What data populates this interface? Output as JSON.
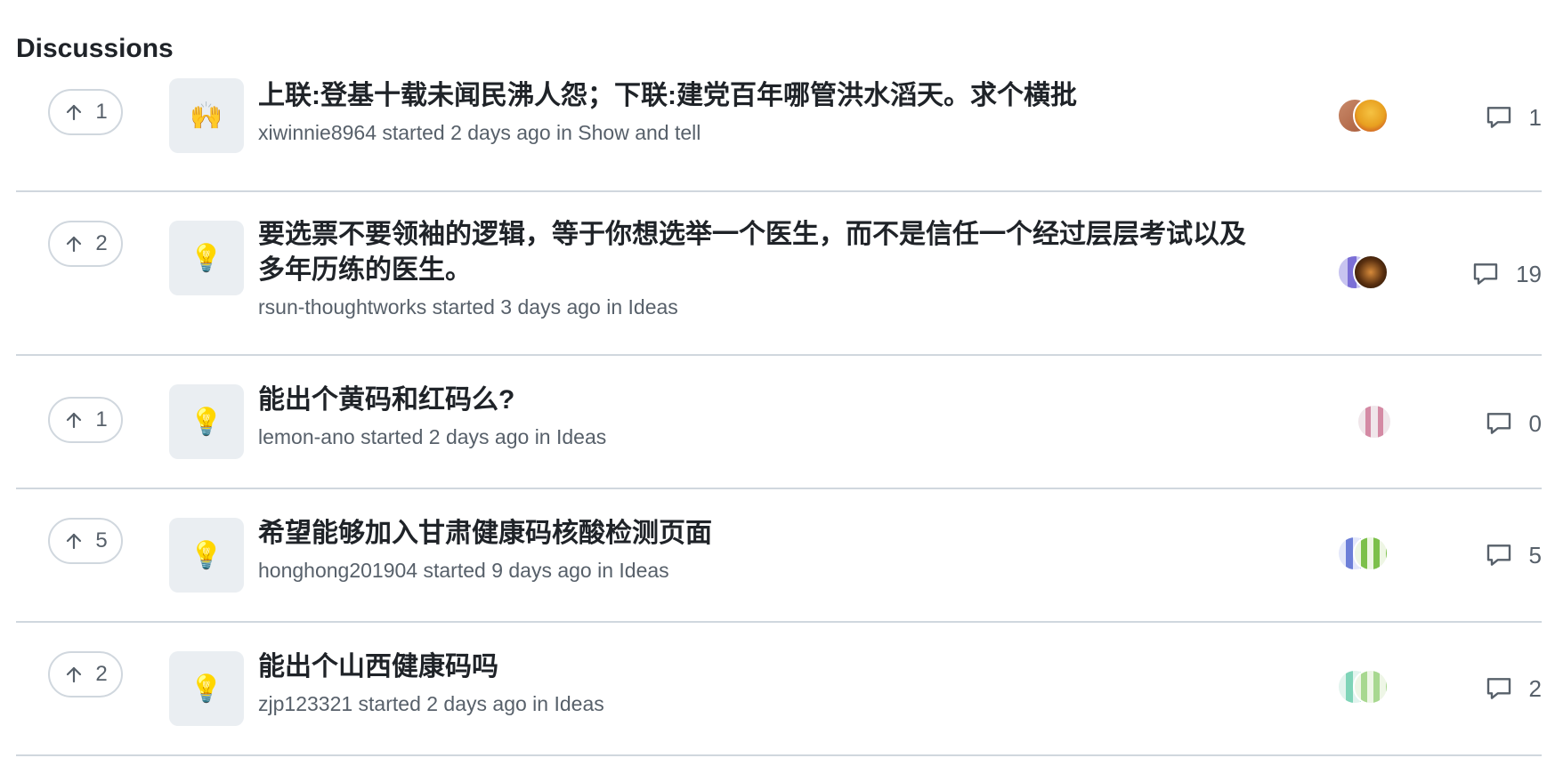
{
  "section": {
    "title": "Discussions"
  },
  "discussions": [
    {
      "votes": "1",
      "category_emoji": "🙌",
      "title": "上联:登基十载未闻民沸人怨；下联:建党百年哪管洪水滔天。求个横批",
      "author": "xiwinnie8964",
      "started": "started 2 days ago in",
      "category": "Show and tell",
      "comments": "1"
    },
    {
      "votes": "2",
      "category_emoji": "💡",
      "title": "要选票不要领袖的逻辑，等于你想选举一个医生，而不是信任一个经过层层考试以及多年历练的医生。",
      "author": "rsun-thoughtworks",
      "started": "started 3 days ago in",
      "category": "Ideas",
      "comments": "19"
    },
    {
      "votes": "1",
      "category_emoji": "💡",
      "title": "能出个黄码和红码么?",
      "author": "lemon-ano",
      "started": "started 2 days ago in",
      "category": "Ideas",
      "comments": "0"
    },
    {
      "votes": "5",
      "category_emoji": "💡",
      "title": "希望能够加入甘肃健康码核酸检测页面",
      "author": "honghong201904",
      "started": "started 9 days ago in",
      "category": "Ideas",
      "comments": "5"
    },
    {
      "votes": "2",
      "category_emoji": "💡",
      "title": "能出个山西健康码吗",
      "author": "zjp123321",
      "started": "started 2 days ago in",
      "category": "Ideas",
      "comments": "2"
    }
  ],
  "icons": {
    "upvote": "arrow-up-icon",
    "comment": "comment-icon"
  },
  "colors": {
    "border": "#d0d7de",
    "muted_text": "#57606a",
    "icon_bg": "#eaeef2"
  }
}
